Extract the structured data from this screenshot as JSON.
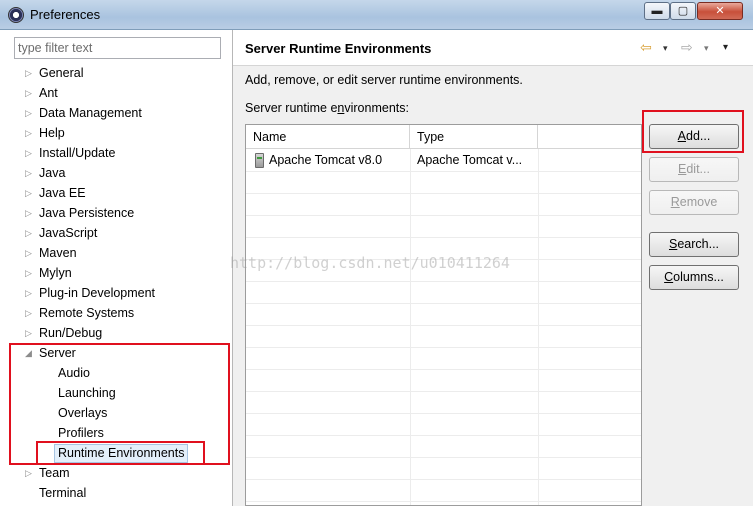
{
  "window": {
    "title": "Preferences",
    "close_label": "✕",
    "min_label": "▬",
    "max_label": "▢"
  },
  "filter": {
    "placeholder": "type filter text",
    "value": ""
  },
  "tree": [
    {
      "label": "General",
      "expander": "▷",
      "level": 0
    },
    {
      "label": "Ant",
      "expander": "▷",
      "level": 0
    },
    {
      "label": "Data Management",
      "expander": "▷",
      "level": 0
    },
    {
      "label": "Help",
      "expander": "▷",
      "level": 0
    },
    {
      "label": "Install/Update",
      "expander": "▷",
      "level": 0
    },
    {
      "label": "Java",
      "expander": "▷",
      "level": 0
    },
    {
      "label": "Java EE",
      "expander": "▷",
      "level": 0
    },
    {
      "label": "Java Persistence",
      "expander": "▷",
      "level": 0
    },
    {
      "label": "JavaScript",
      "expander": "▷",
      "level": 0
    },
    {
      "label": "Maven",
      "expander": "▷",
      "level": 0
    },
    {
      "label": "Mylyn",
      "expander": "▷",
      "level": 0
    },
    {
      "label": "Plug-in Development",
      "expander": "▷",
      "level": 0
    },
    {
      "label": "Remote Systems",
      "expander": "▷",
      "level": 0
    },
    {
      "label": "Run/Debug",
      "expander": "▷",
      "level": 0
    },
    {
      "label": "Server",
      "expander": "◢",
      "level": 0
    },
    {
      "label": "Audio",
      "expander": "",
      "level": 1
    },
    {
      "label": "Launching",
      "expander": "",
      "level": 1
    },
    {
      "label": "Overlays",
      "expander": "",
      "level": 1
    },
    {
      "label": "Profilers",
      "expander": "",
      "level": 1
    },
    {
      "label": "Runtime Environments",
      "expander": "",
      "level": 1,
      "selected": true
    },
    {
      "label": "Team",
      "expander": "▷",
      "level": 0
    },
    {
      "label": "Terminal",
      "expander": "",
      "level": 0
    }
  ],
  "page": {
    "title": "Server Runtime Environments",
    "description": "Add, remove, or edit server runtime environments.",
    "list_label_pre": "Server runtime e",
    "list_label_mnemonic": "n",
    "list_label_post": "vironments:",
    "nav_back": "⇦",
    "nav_fwd": "⇨",
    "dropdown": "▾"
  },
  "table": {
    "columns": [
      "Name",
      "Type"
    ],
    "rows": [
      {
        "name": "Apache Tomcat v8.0",
        "type": "Apache Tomcat v..."
      }
    ]
  },
  "buttons": {
    "add": {
      "mnemonic": "A",
      "rest": "dd..."
    },
    "edit": {
      "mnemonic": "E",
      "rest": "dit..."
    },
    "remove": {
      "mnemonic": "R",
      "rest": "emove"
    },
    "search": {
      "mnemonic": "S",
      "rest": "earch..."
    },
    "columns": {
      "mnemonic": "C",
      "rest": "olumns..."
    }
  },
  "watermark": "http://blog.csdn.net/u010411264",
  "colors": {
    "highlight": "#e0101e",
    "selection": "#e3effa"
  }
}
